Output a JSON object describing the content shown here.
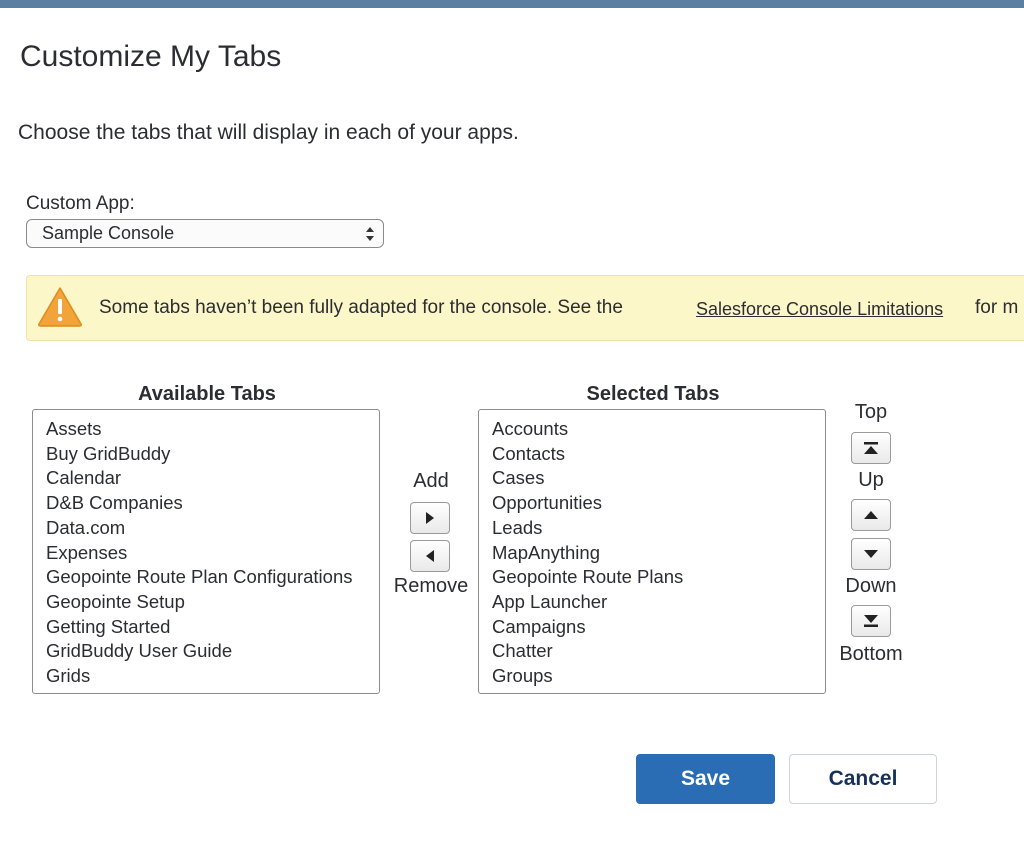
{
  "page": {
    "title": "Customize My Tabs",
    "subtitle": "Choose the tabs that will display in each of your apps."
  },
  "custom_app": {
    "label": "Custom App:",
    "selected": "Sample Console"
  },
  "warning": {
    "text": "Some tabs haven’t been fully adapted for the console. See the",
    "link": "Salesforce Console Limitations",
    "tail": "for m",
    "icon": "warning-icon"
  },
  "available": {
    "heading": "Available Tabs",
    "items": [
      "Assets",
      "Buy GridBuddy",
      "Calendar",
      "D&B Companies",
      "Data.com",
      "Expenses",
      "Geopointe Route Plan Configurations",
      "Geopointe Setup",
      "Getting Started",
      "GridBuddy User Guide",
      "Grids"
    ]
  },
  "selected": {
    "heading": "Selected Tabs",
    "items": [
      "Accounts",
      "Contacts",
      "Cases",
      "Opportunities",
      "Leads",
      "MapAnything",
      "Geopointe Route Plans",
      "App Launcher",
      "Campaigns",
      "Chatter",
      "Groups"
    ]
  },
  "transfer": {
    "add": "Add",
    "remove": "Remove"
  },
  "order": {
    "top": "Top",
    "up": "Up",
    "down": "Down",
    "bottom": "Bottom"
  },
  "actions": {
    "save": "Save",
    "cancel": "Cancel"
  },
  "colors": {
    "primary": "#2a6db5",
    "warning_bg": "#fcf7c9",
    "warning_icon": "#f2a33a"
  }
}
